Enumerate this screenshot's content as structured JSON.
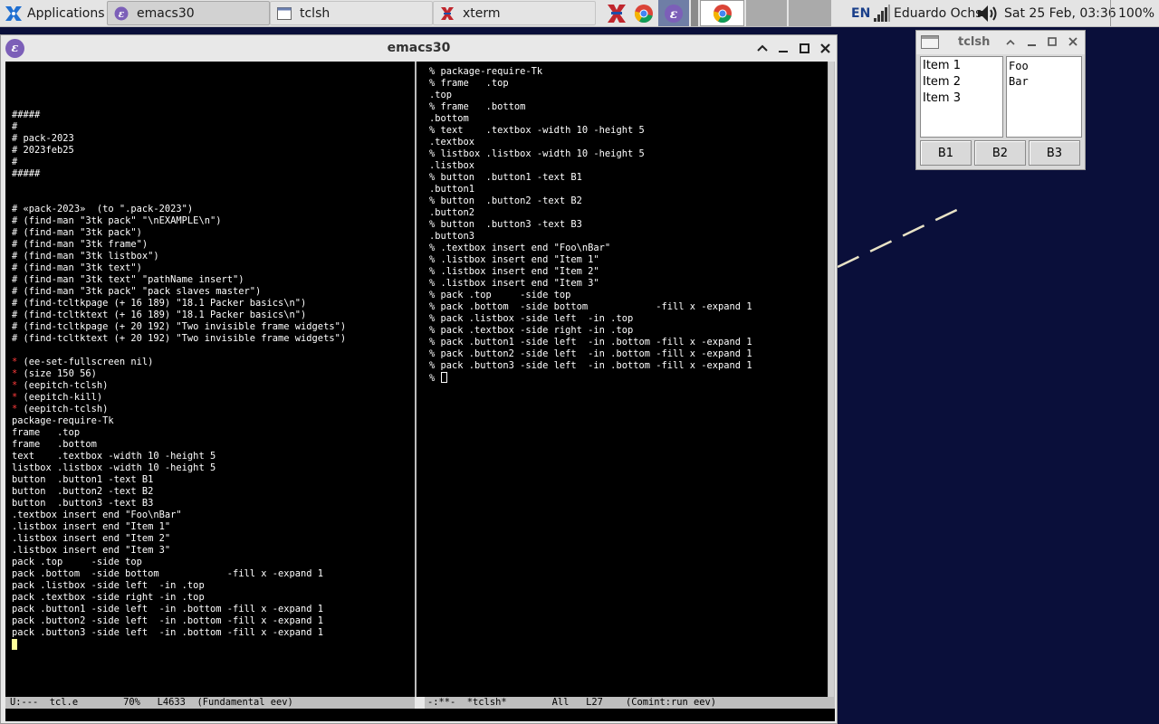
{
  "panel": {
    "applications_label": "Applications",
    "tasks": [
      {
        "label": "emacs30",
        "icon": "emacs-icon",
        "active": true
      },
      {
        "label": "tclsh",
        "icon": "window-icon",
        "active": false
      },
      {
        "label": "xterm",
        "icon": "xterm-icon",
        "active": false
      }
    ],
    "launchers": [
      "xterm-launcher-icon",
      "chrome-launcher-icon",
      "emacs-launcher-icon",
      "chrome-launcher-icon"
    ],
    "keyboard_layout": "EN",
    "user_name": "Eduardo Ochs",
    "clock": "Sat 25 Feb, 03:36",
    "battery": "100%"
  },
  "emacs": {
    "title": "emacs30",
    "left_lines": [
      "",
      "",
      "#####",
      "#",
      "# pack-2023",
      "# 2023feb25",
      "#",
      "#####",
      "",
      "",
      "# «pack-2023»  (to \".pack-2023\")",
      "# (find-man \"3tk pack\" \"\\nEXAMPLE\\n\")",
      "# (find-man \"3tk pack\")",
      "# (find-man \"3tk frame\")",
      "# (find-man \"3tk listbox\")",
      "# (find-man \"3tk text\")",
      "# (find-man \"3tk text\" \"pathName insert\")",
      "# (find-man \"3tk pack\" \"pack slaves master\")",
      "# (find-tcltkpage (+ 16 189) \"18.1 Packer basics\\n\")",
      "# (find-tcltktext (+ 16 189) \"18.1 Packer basics\\n\")",
      "# (find-tcltkpage (+ 20 192) \"Two invisible frame widgets\")",
      "# (find-tcltktext (+ 20 192) \"Two invisible frame widgets\")",
      "",
      "* (ee-set-fullscreen nil)",
      "* (size 150 56)",
      "* (eepitch-tclsh)",
      "* (eepitch-kill)",
      "* (eepitch-tclsh)",
      "package-require-Tk",
      "frame   .top",
      "frame   .bottom",
      "text    .textbox -width 10 -height 5",
      "listbox .listbox -width 10 -height 5",
      "button  .button1 -text B1",
      "button  .button2 -text B2",
      "button  .button3 -text B3",
      ".textbox insert end \"Foo\\nBar\"",
      ".listbox insert end \"Item 1\"",
      ".listbox insert end \"Item 2\"",
      ".listbox insert end \"Item 3\"",
      "pack .top     -side top",
      "pack .bottom  -side bottom            -fill x -expand 1",
      "pack .listbox -side left  -in .top",
      "pack .textbox -side right -in .top",
      "pack .button1 -side left  -in .bottom -fill x -expand 1",
      "pack .button2 -side left  -in .bottom -fill x -expand 1",
      "pack .button3 -side left  -in .bottom -fill x -expand 1"
    ],
    "right_lines": [
      "% package-require-Tk",
      "% frame   .top",
      ".top",
      "% frame   .bottom",
      ".bottom",
      "% text    .textbox -width 10 -height 5",
      ".textbox",
      "% listbox .listbox -width 10 -height 5",
      ".listbox",
      "% button  .button1 -text B1",
      ".button1",
      "% button  .button2 -text B2",
      ".button2",
      "% button  .button3 -text B3",
      ".button3",
      "% .textbox insert end \"Foo\\nBar\"",
      "% .listbox insert end \"Item 1\"",
      "% .listbox insert end \"Item 2\"",
      "% .listbox insert end \"Item 3\"",
      "% pack .top     -side top",
      "% pack .bottom  -side bottom            -fill x -expand 1",
      "% pack .listbox -side left  -in .top",
      "% pack .textbox -side right -in .top",
      "% pack .button1 -side left  -in .bottom -fill x -expand 1",
      "% pack .button2 -side left  -in .bottom -fill x -expand 1",
      "% pack .button3 -side left  -in .bottom -fill x -expand 1"
    ],
    "right_prompt": "% ",
    "modeline_left": "U:---  tcl.e        70%   L4633  (Fundamental eev)",
    "modeline_right": "-:**-  *tclsh*        All   L27    (Comint:run eev)"
  },
  "tclsh": {
    "title": "tclsh",
    "listbox_items": [
      "Item 1",
      "Item 2",
      "Item 3"
    ],
    "textbox_text": "Foo\nBar",
    "buttons": [
      "B1",
      "B2",
      "B3"
    ]
  }
}
